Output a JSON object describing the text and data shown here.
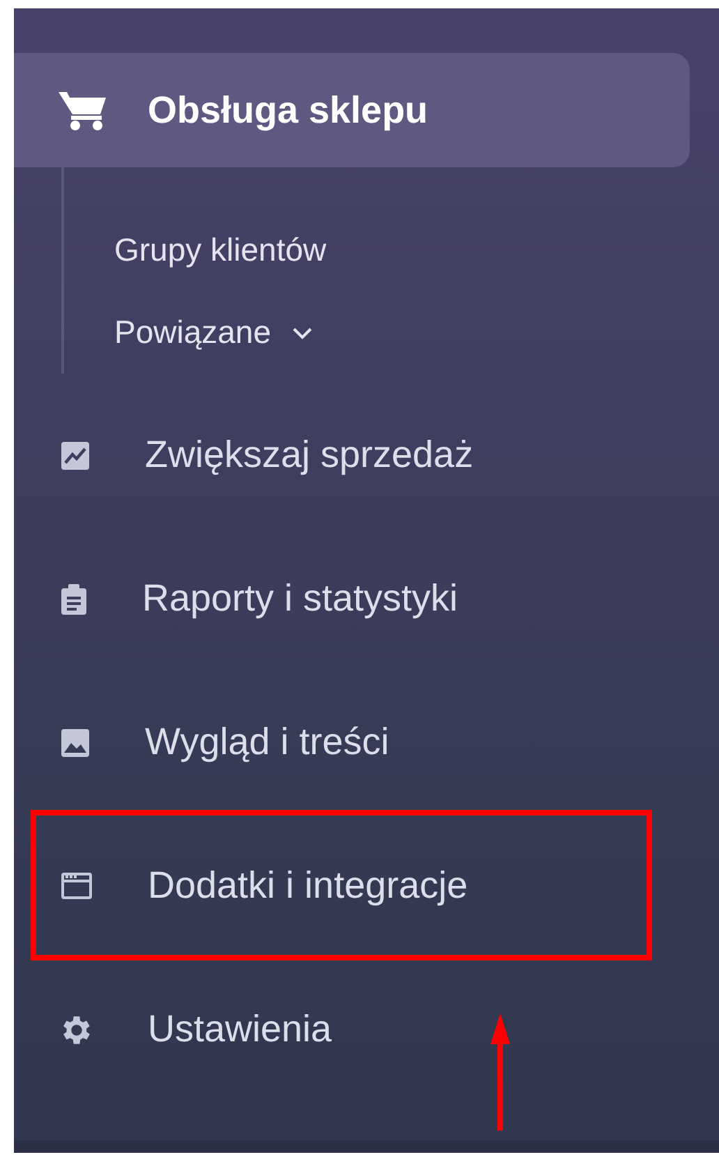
{
  "sidebar": {
    "section": {
      "label": "Obsługa sklepu",
      "selected": true,
      "expanded": true,
      "children": [
        {
          "label": "Grupy klientów",
          "selected": false,
          "has_submenu": false
        },
        {
          "label": "Powiązane",
          "selected": false,
          "has_submenu": true
        }
      ]
    },
    "items": [
      {
        "label": "Zwiększaj sprzedaż",
        "selected": false,
        "annotated": false
      },
      {
        "label": "Raporty i statystyki",
        "selected": false,
        "annotated": false
      },
      {
        "label": "Wygląd i treści",
        "selected": false,
        "annotated": false
      },
      {
        "label": "Dodatki i integracje",
        "selected": false,
        "annotated": true
      },
      {
        "label": "Ustawienia",
        "selected": false,
        "annotated": false
      }
    ]
  }
}
